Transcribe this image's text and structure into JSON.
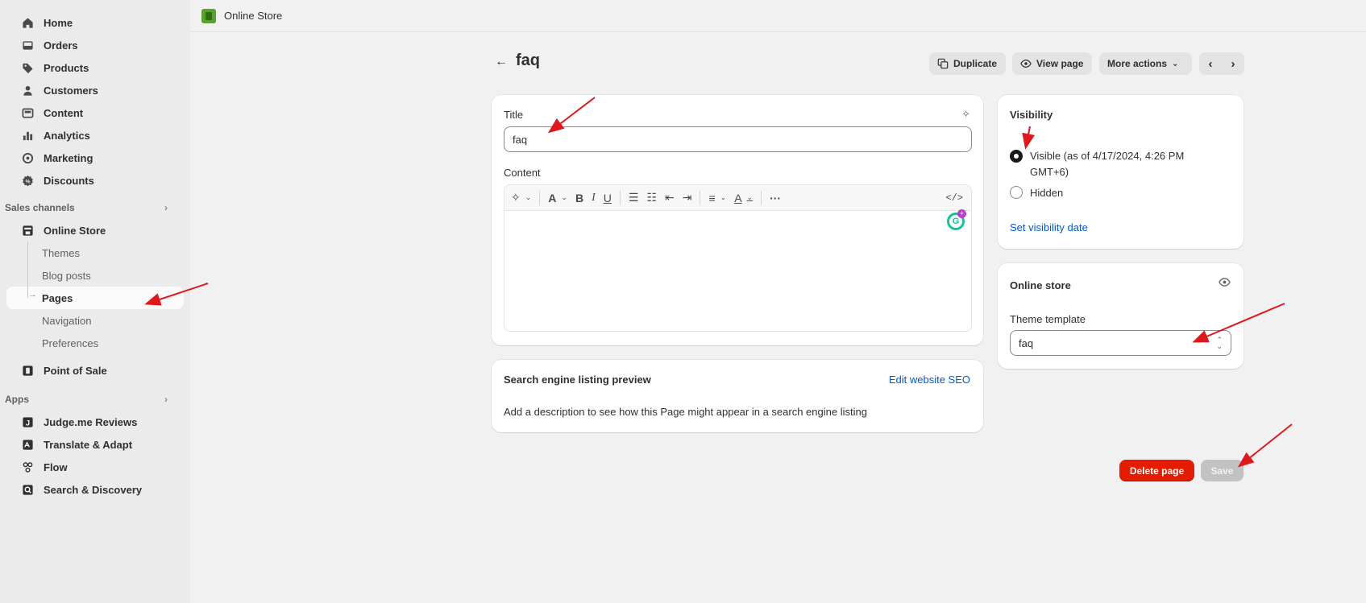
{
  "sidebar": {
    "main_items": [
      {
        "label": "Home",
        "icon": "home-icon"
      },
      {
        "label": "Orders",
        "icon": "inbox-icon"
      },
      {
        "label": "Products",
        "icon": "tag-icon"
      },
      {
        "label": "Customers",
        "icon": "person-icon"
      },
      {
        "label": "Content",
        "icon": "content-icon"
      },
      {
        "label": "Analytics",
        "icon": "bar-chart-icon"
      },
      {
        "label": "Marketing",
        "icon": "target-icon"
      },
      {
        "label": "Discounts",
        "icon": "discount-icon"
      }
    ],
    "sales_channels_heading": "Sales channels",
    "online_store": "Online Store",
    "online_store_sub": [
      "Themes",
      "Blog posts",
      "Pages",
      "Navigation",
      "Preferences"
    ],
    "point_of_sale": "Point of Sale",
    "apps_heading": "Apps",
    "apps": [
      {
        "label": "Judge.me Reviews",
        "icon": "judgeme-icon"
      },
      {
        "label": "Translate & Adapt",
        "icon": "translate-icon"
      },
      {
        "label": "Flow",
        "icon": "flow-icon"
      },
      {
        "label": "Search & Discovery",
        "icon": "search-discovery-icon"
      }
    ]
  },
  "topbar": {
    "title": "Online Store"
  },
  "header": {
    "title": "faq",
    "duplicate": "Duplicate",
    "view_page": "View page",
    "more_actions": "More actions"
  },
  "editor": {
    "title_label": "Title",
    "title_value": "faq",
    "content_label": "Content"
  },
  "seo": {
    "heading": "Search engine listing preview",
    "edit_link": "Edit website SEO",
    "description": "Add a description to see how this Page might appear in a search engine listing"
  },
  "visibility": {
    "heading": "Visibility",
    "visible_label": "Visible (as of 4/17/2024, 4:26 PM GMT+6)",
    "hidden_label": "Hidden",
    "set_date_link": "Set visibility date",
    "selected": "Visible"
  },
  "online_store_card": {
    "heading": "Online store",
    "template_label": "Theme template",
    "template_value": "faq"
  },
  "actions": {
    "delete": "Delete page",
    "save": "Save"
  },
  "colors": {
    "delete": "#e51c00",
    "save_disabled": "#c2c2c2",
    "link": "#005bd3",
    "annotation_arrow": "#e0181b"
  }
}
